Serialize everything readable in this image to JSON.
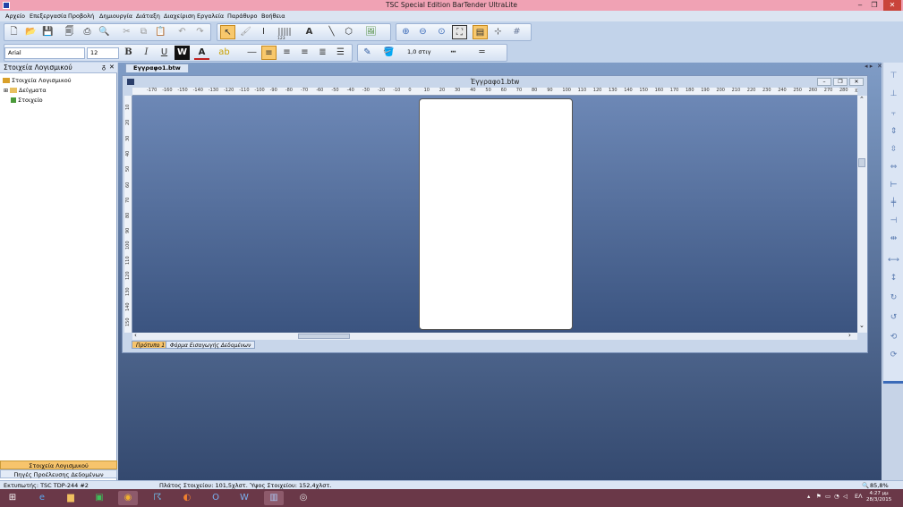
{
  "app": {
    "title": "TSC Special Edition BarTender UltraLite"
  },
  "menu": [
    "Αρχείο",
    "Επεξεργασία",
    "Προβολή",
    "Δημιουργία",
    "Διάταξη",
    "Διαχείριση",
    "Εργαλεία",
    "Παράθυρο",
    "Βοήθεια"
  ],
  "toolbar": {
    "font_name": "Arial",
    "font_size": "12",
    "bold": "B",
    "italic": "I",
    "underline": "U",
    "reverse": "W",
    "line_width": "1,0 στιγ",
    "barcode_label": "123"
  },
  "left_panel": {
    "title": "Στοιχεία Λογισμικού",
    "tree": [
      "Στοιχεία Λογισμικού",
      "Δείγματα",
      "Στοιχείο"
    ],
    "tabs": [
      "Στοιχεία Λογισμικού",
      "Πηγές Προέλευσης Δεδομένων"
    ]
  },
  "document": {
    "tab": "Εγγραφο1.btw",
    "title": "Έγγραφο1.btw",
    "sheet_tabs": [
      "Πρότυπο 1",
      "Φόρμα Εισαγωγής Δεδομένων"
    ],
    "ruler_h": [
      "-170",
      "-160",
      "-150",
      "-140",
      "-130",
      "-120",
      "-110",
      "-100",
      "-90",
      "-80",
      "-70",
      "-60",
      "-50",
      "-40",
      "-30",
      "-20",
      "-10",
      "0",
      "10",
      "20",
      "30",
      "40",
      "50",
      "60",
      "70",
      "80",
      "90",
      "100",
      "110",
      "120",
      "130",
      "140",
      "150",
      "160",
      "170",
      "180",
      "190",
      "200",
      "210",
      "220",
      "230",
      "240",
      "250",
      "260",
      "270",
      "280",
      "χιλ"
    ],
    "ruler_v": [
      "10",
      "20",
      "30",
      "40",
      "50",
      "60",
      "70",
      "80",
      "90",
      "100",
      "110",
      "120",
      "130",
      "140",
      "150"
    ]
  },
  "status": {
    "printer": "Εκτυπωτής: TSC TDP-244 #2",
    "dimensions": "Πλάτος Στοιχείου: 101,5χλστ.  Ύψος Στοιχείου: 152,4χλστ.",
    "zoom": "85,8%"
  },
  "taskbar": {
    "lang": "ΕΛ",
    "time": "4:27 μμ",
    "date": "28/3/2015"
  }
}
